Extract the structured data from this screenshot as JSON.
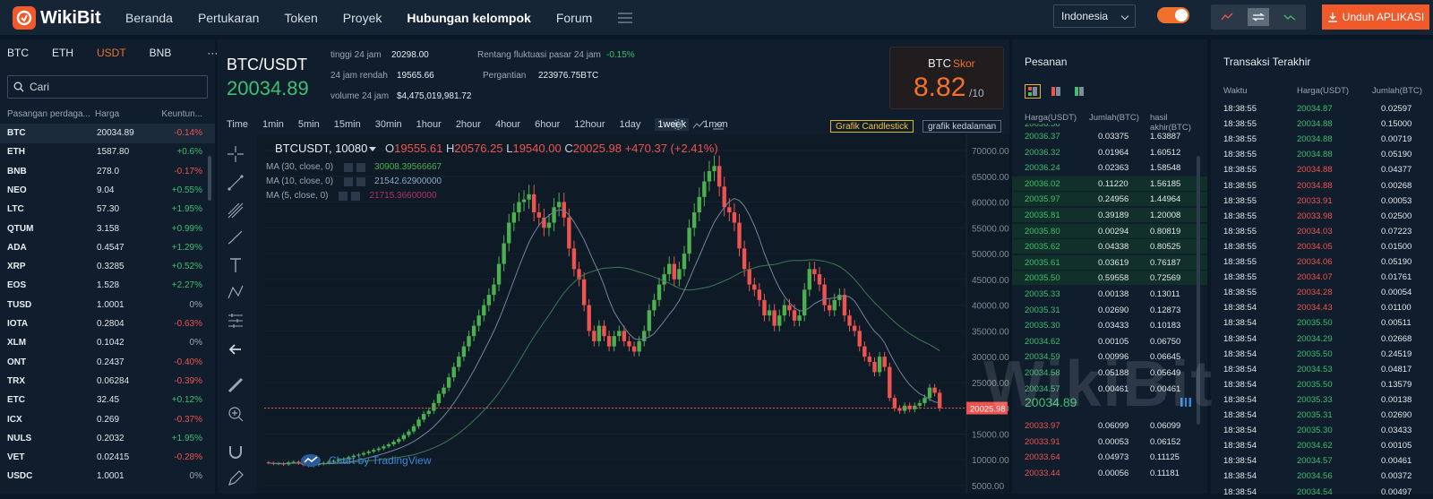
{
  "header": {
    "logo_text": "WikiBit",
    "nav": [
      "Beranda",
      "Pertukaran",
      "Token",
      "Proyek",
      "Hubungan kelompok",
      "Forum"
    ],
    "language": "Indonesia",
    "download_label": "Unduh APLIKASI"
  },
  "markets": {
    "tabs": [
      "BTC",
      "ETH",
      "USDT",
      "BNB",
      "···"
    ],
    "active_tab": "USDT",
    "search_placeholder": "Cari",
    "col_pair": "Pasangan perdaga...",
    "col_price": "Harga",
    "col_change": "Keuntun...",
    "rows": [
      {
        "pair": "BTC",
        "price": "20034.89",
        "change": "-0.14%"
      },
      {
        "pair": "ETH",
        "price": "1587.80",
        "change": "+0.6%"
      },
      {
        "pair": "BNB",
        "price": "278.0",
        "change": "-0.17%"
      },
      {
        "pair": "NEO",
        "price": "9.04",
        "change": "+0.55%"
      },
      {
        "pair": "LTC",
        "price": "57.30",
        "change": "+1.95%"
      },
      {
        "pair": "QTUM",
        "price": "3.158",
        "change": "+0.99%"
      },
      {
        "pair": "ADA",
        "price": "0.4547",
        "change": "+1.29%"
      },
      {
        "pair": "XRP",
        "price": "0.3285",
        "change": "+0.52%"
      },
      {
        "pair": "EOS",
        "price": "1.528",
        "change": "+2.27%"
      },
      {
        "pair": "TUSD",
        "price": "1.0001",
        "change": "0%"
      },
      {
        "pair": "IOTA",
        "price": "0.2804",
        "change": "-0.63%"
      },
      {
        "pair": "XLM",
        "price": "0.1042",
        "change": "0%"
      },
      {
        "pair": "ONT",
        "price": "0.2437",
        "change": "-0.40%"
      },
      {
        "pair": "TRX",
        "price": "0.06284",
        "change": "-0.39%"
      },
      {
        "pair": "ETC",
        "price": "32.45",
        "change": "+0.12%"
      },
      {
        "pair": "ICX",
        "price": "0.269",
        "change": "-0.37%"
      },
      {
        "pair": "NULS",
        "price": "0.2032",
        "change": "+1.95%"
      },
      {
        "pair": "VET",
        "price": "0.02415",
        "change": "-0.28%"
      },
      {
        "pair": "USDC",
        "price": "1.0001",
        "change": "0%"
      }
    ]
  },
  "ticker": {
    "pair": "BTC/USDT",
    "price": "20034.89",
    "high_label": "tinggi 24 jam",
    "high": "20298.00",
    "low_label": "24 jam rendah",
    "low": "19565.66",
    "vol_label": "volume 24 jam",
    "vol": "$4,475,019,981.72",
    "range_label": "Rentang fluktuasi pasar 24 jam",
    "range": "-0.15%",
    "turnover_label": "Pergantian",
    "turnover": "223976.75BTC",
    "score_coin": "BTC",
    "score_label": "Skor",
    "score": "8.82",
    "score_max": "/10"
  },
  "timeframes": [
    "Time",
    "1min",
    "5min",
    "15min",
    "30min",
    "1hour",
    "2hour",
    "4hour",
    "6hour",
    "12hour",
    "1day",
    "1week",
    "1mon"
  ],
  "active_timeframe": "1week",
  "chart_buttons": {
    "candle": "Grafik Candlestick",
    "depth": "grafik kedalaman"
  },
  "chart_data": {
    "type": "candlestick",
    "symbol": "BTCUSDT, 10080",
    "ohlc": {
      "O": "19555.61",
      "H": "20576.25",
      "L": "19540.00",
      "C": "20025.98",
      "change": "+470.37 (+2.41%)"
    },
    "ma": [
      {
        "label": "MA (30, close, 0)",
        "value": "30908.39566667",
        "color": "#4caf50"
      },
      {
        "label": "MA (10, close, 0)",
        "value": "21542.62900000",
        "color": "#8fa8c8"
      },
      {
        "label": "MA (5, close, 0)",
        "value": "21715.36600000",
        "color": "#b0326a"
      }
    ],
    "y_ticks": [
      "70000.00",
      "65000.00",
      "60000.00",
      "55000.00",
      "50000.00",
      "45000.00",
      "40000.00",
      "35000.00",
      "30000.00",
      "25000.00",
      "20000.00",
      "15000.00",
      "10000.00",
      "5000.00"
    ],
    "ylim": [
      5000,
      70000
    ],
    "last_price_label": "20025.98",
    "attribution": "Chart by TradingView",
    "closes": [
      9400,
      9200,
      9300,
      9100,
      9500,
      9600,
      9300,
      9000,
      8800,
      9000,
      9200,
      9400,
      9600,
      9800,
      10000,
      10200,
      10500,
      10800,
      11000,
      11300,
      11600,
      11900,
      12200,
      12600,
      13000,
      13500,
      14000,
      14800,
      15500,
      16500,
      17800,
      18900,
      19500,
      21000,
      22800,
      24000,
      26000,
      28000,
      30000,
      32000,
      34000,
      36000,
      38000,
      40000,
      42000,
      44000,
      48000,
      52000,
      56000,
      58000,
      60000,
      60500,
      61500,
      58000,
      57000,
      55000,
      56000,
      59000,
      60000,
      57000,
      51000,
      47000,
      45000,
      40000,
      35000,
      33000,
      36000,
      34000,
      32000,
      34000,
      35000,
      33000,
      32000,
      31000,
      33000,
      35000,
      39000,
      41000,
      44000,
      46000,
      48000,
      45000,
      47000,
      50000,
      55000,
      58000,
      61000,
      64000,
      66000,
      67000,
      63000,
      59000,
      58000,
      56000,
      51000,
      47000,
      44000,
      43000,
      41000,
      38000,
      39000,
      36000,
      38000,
      40000,
      39000,
      37000,
      38000,
      43000,
      47000,
      46000,
      44000,
      40000,
      39000,
      41000,
      42000,
      38000,
      36000,
      35000,
      32000,
      30000,
      29000,
      27000,
      30000,
      28000,
      22000,
      20000,
      19500,
      20500,
      19800,
      20500,
      21000,
      22000,
      24000,
      23000,
      20025
    ]
  },
  "orderbook": {
    "title": "Pesanan",
    "col_price": "Harga(USDT)",
    "col_amount": "Jumlah(BTC)",
    "col_total": "hasil akhir(BTC)",
    "top_partial": "20036.56",
    "asks": [
      {
        "p": "20036.37",
        "a": "0.03375",
        "t": "1.63887"
      },
      {
        "p": "20036.32",
        "a": "0.01964",
        "t": "1.60512"
      },
      {
        "p": "20036.24",
        "a": "0.02363",
        "t": "1.58548"
      },
      {
        "p": "20036.02",
        "a": "0.11220",
        "t": "1.56185"
      },
      {
        "p": "20035.97",
        "a": "0.24956",
        "t": "1.44964"
      },
      {
        "p": "20035.81",
        "a": "0.39189",
        "t": "1.20008"
      },
      {
        "p": "20035.80",
        "a": "0.00294",
        "t": "0.80819"
      },
      {
        "p": "20035.62",
        "a": "0.04338",
        "t": "0.80525"
      },
      {
        "p": "20035.61",
        "a": "0.03619",
        "t": "0.76187"
      },
      {
        "p": "20035.50",
        "a": "0.59558",
        "t": "0.72569"
      },
      {
        "p": "20035.33",
        "a": "0.00138",
        "t": "0.13011"
      },
      {
        "p": "20035.31",
        "a": "0.02690",
        "t": "0.12873"
      },
      {
        "p": "20035.30",
        "a": "0.03433",
        "t": "0.10183"
      },
      {
        "p": "20034.62",
        "a": "0.00105",
        "t": "0.06750"
      },
      {
        "p": "20034.59",
        "a": "0.00996",
        "t": "0.06645"
      },
      {
        "p": "20034.58",
        "a": "0.05188",
        "t": "0.05649"
      },
      {
        "p": "20034.57",
        "a": "0.00461",
        "t": "0.00461"
      }
    ],
    "mid": "20034.89",
    "bids": [
      {
        "p": "20033.97",
        "a": "0.06099",
        "t": "0.06099"
      },
      {
        "p": "20033.91",
        "a": "0.00053",
        "t": "0.06152"
      },
      {
        "p": "20033.64",
        "a": "0.04973",
        "t": "0.11125"
      },
      {
        "p": "20033.44",
        "a": "0.00056",
        "t": "0.11181"
      }
    ]
  },
  "trades": {
    "title": "Transaksi Terakhir",
    "col_time": "Waktu",
    "col_price": "Harga(USDT)",
    "col_amount": "Jumlah(BTC)",
    "rows": [
      {
        "t": "18:38:55",
        "p": "20034.87",
        "a": "0.02597",
        "s": "g"
      },
      {
        "t": "18:38:55",
        "p": "20034.88",
        "a": "0.15000",
        "s": "g"
      },
      {
        "t": "18:38:55",
        "p": "20034.88",
        "a": "0.00719",
        "s": "g"
      },
      {
        "t": "18:38:55",
        "p": "20034.88",
        "a": "0.05190",
        "s": "g"
      },
      {
        "t": "18:38:55",
        "p": "20034.88",
        "a": "0.04377",
        "s": "r"
      },
      {
        "t": "18:38:55",
        "p": "20034.88",
        "a": "0.00268",
        "s": "r"
      },
      {
        "t": "18:38:55",
        "p": "20033.91",
        "a": "0.00053",
        "s": "r"
      },
      {
        "t": "18:38:55",
        "p": "20033.98",
        "a": "0.02500",
        "s": "r"
      },
      {
        "t": "18:38:55",
        "p": "20034.03",
        "a": "0.07223",
        "s": "r"
      },
      {
        "t": "18:38:55",
        "p": "20034.05",
        "a": "0.01500",
        "s": "r"
      },
      {
        "t": "18:38:55",
        "p": "20034.06",
        "a": "0.05190",
        "s": "r"
      },
      {
        "t": "18:38:55",
        "p": "20034.07",
        "a": "0.01761",
        "s": "r"
      },
      {
        "t": "18:38:55",
        "p": "20034.28",
        "a": "0.00054",
        "s": "r"
      },
      {
        "t": "18:38:54",
        "p": "20034.43",
        "a": "0.01100",
        "s": "r"
      },
      {
        "t": "18:38:54",
        "p": "20035.50",
        "a": "0.00511",
        "s": "g"
      },
      {
        "t": "18:38:54",
        "p": "20034.29",
        "a": "0.02668",
        "s": "g"
      },
      {
        "t": "18:38:54",
        "p": "20035.50",
        "a": "0.24519",
        "s": "g"
      },
      {
        "t": "18:38:54",
        "p": "20034.53",
        "a": "0.04817",
        "s": "g"
      },
      {
        "t": "18:38:54",
        "p": "20035.50",
        "a": "0.13579",
        "s": "g"
      },
      {
        "t": "18:38:54",
        "p": "20035.33",
        "a": "0.00138",
        "s": "g"
      },
      {
        "t": "18:38:54",
        "p": "20035.31",
        "a": "0.02690",
        "s": "g"
      },
      {
        "t": "18:38:54",
        "p": "20035.30",
        "a": "0.03433",
        "s": "g"
      },
      {
        "t": "18:38:54",
        "p": "20034.62",
        "a": "0.00105",
        "s": "g"
      },
      {
        "t": "18:38:54",
        "p": "20034.57",
        "a": "0.00461",
        "s": "g"
      },
      {
        "t": "18:38:54",
        "p": "20034.56",
        "a": "0.00372",
        "s": "g"
      },
      {
        "t": "18:38:54",
        "p": "20034.54",
        "a": "0.00497",
        "s": "g"
      }
    ]
  },
  "watermark": "WikiBit",
  "colors": {
    "accent": "#f0592a",
    "up": "#3fbf6f",
    "down": "#ef5350"
  }
}
